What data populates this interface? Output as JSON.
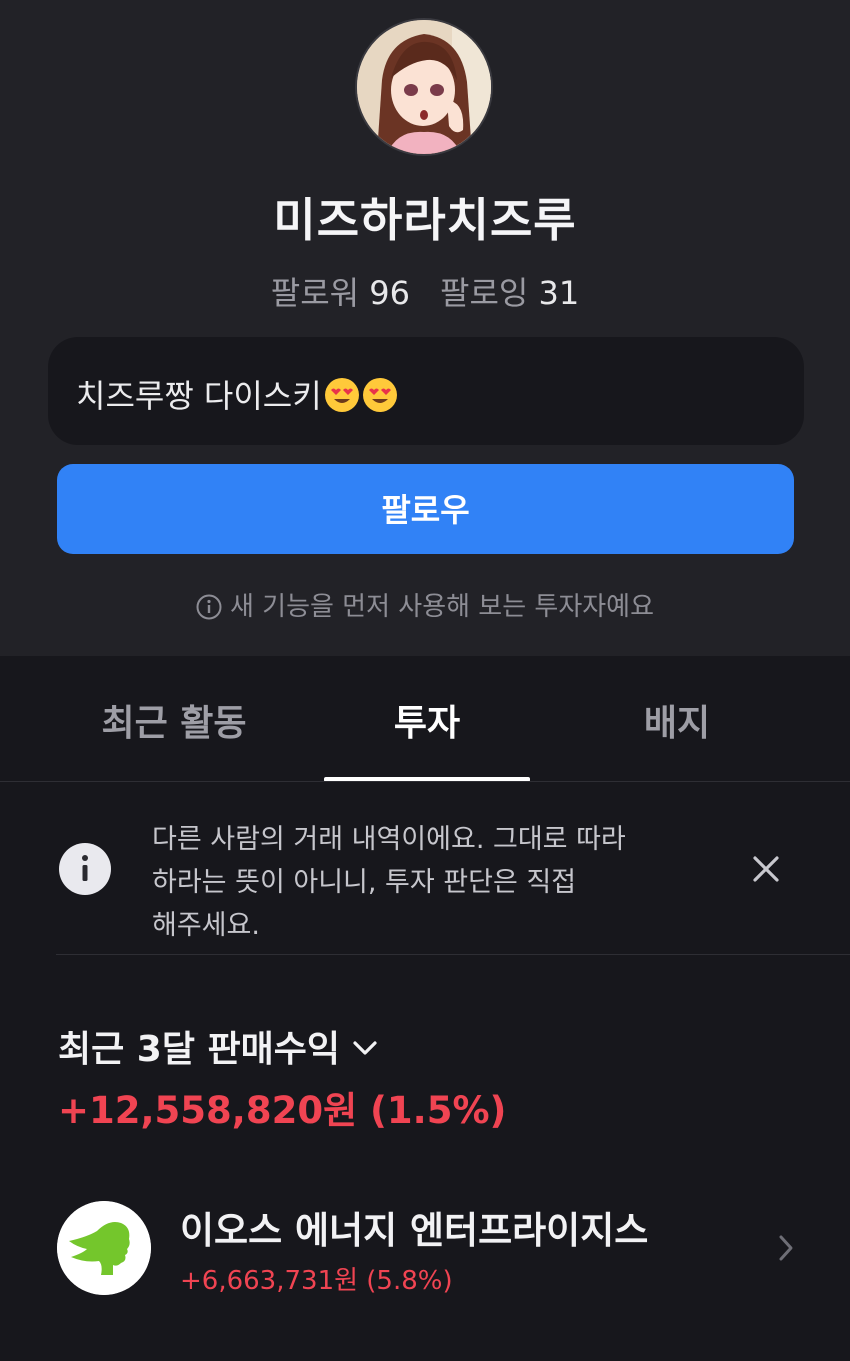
{
  "profile": {
    "username": "미즈하라치즈루",
    "follower_label": "팔로워",
    "follower_count": "96",
    "following_label": "팔로잉",
    "following_count": "31",
    "bio": "치즈루짱 다이스키",
    "bio_emojis": [
      "heart-eyes-emoji",
      "heart-eyes-emoji"
    ],
    "follow_button_label": "팔로우",
    "notice": "새 기능을 먼저 사용해 보는 투자자예요"
  },
  "tabs": [
    {
      "label": "최근 활동",
      "active": false
    },
    {
      "label": "투자",
      "active": true
    },
    {
      "label": "배지",
      "active": false
    }
  ],
  "info_banner": {
    "line1": "다른 사람의 거래 내역이에요. 그대로 따라",
    "line2": "하라는 뜻이 아니니, 투자 판단은 직접",
    "line3": "해주세요."
  },
  "summary": {
    "period_label": "최근 3달 판매수익",
    "profit": "+12,558,820원 (1.5%)"
  },
  "stocks": [
    {
      "name": "이오스 에너지 엔터프라이지스",
      "profit": "+6,663,731원 (5.8%)"
    }
  ],
  "colors": {
    "accent_blue": "#3182f6",
    "profit_red": "#f04452",
    "logo_green": "#74c62c",
    "background": "#17171c",
    "card_background": "#222227"
  }
}
